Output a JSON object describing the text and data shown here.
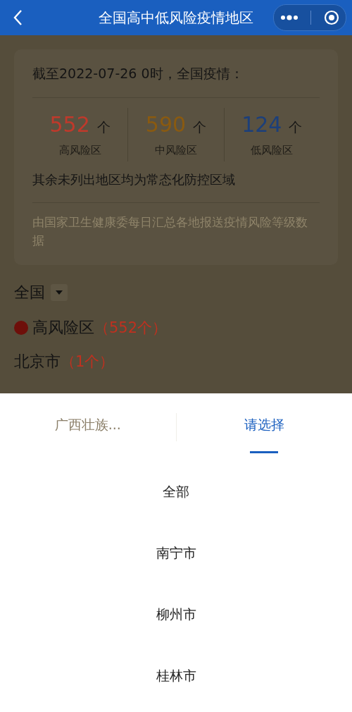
{
  "header": {
    "title": "全国高中低风险疫情地区"
  },
  "summary": {
    "heading": "截至2022-07-26 0时，全国疫情：",
    "stats": [
      {
        "value": "552",
        "unit": "个",
        "label": "高风险区",
        "color": "#c0392b"
      },
      {
        "value": "590",
        "unit": "个",
        "label": "中风险区",
        "color": "#8a5a10"
      },
      {
        "value": "124",
        "unit": "个",
        "label": "低风险区",
        "color": "#1c3f7a"
      }
    ],
    "note": "其余未列出地区均为常态化防控区域",
    "source": "由国家卫生健康委每日汇总各地报送疫情风险等级数据"
  },
  "region_filter": {
    "value": "全国"
  },
  "risk_section": {
    "title": "高风险区",
    "count": "（552个）",
    "color": "#6e0f0a"
  },
  "cities": [
    {
      "name": "北京市",
      "count": "（1个）"
    }
  ],
  "picker": {
    "tabs": [
      {
        "label": "广西壮族...",
        "selected": false
      },
      {
        "label": "请选择",
        "selected": true
      }
    ],
    "options": [
      "全部",
      "南宁市",
      "柳州市",
      "桂林市"
    ]
  }
}
